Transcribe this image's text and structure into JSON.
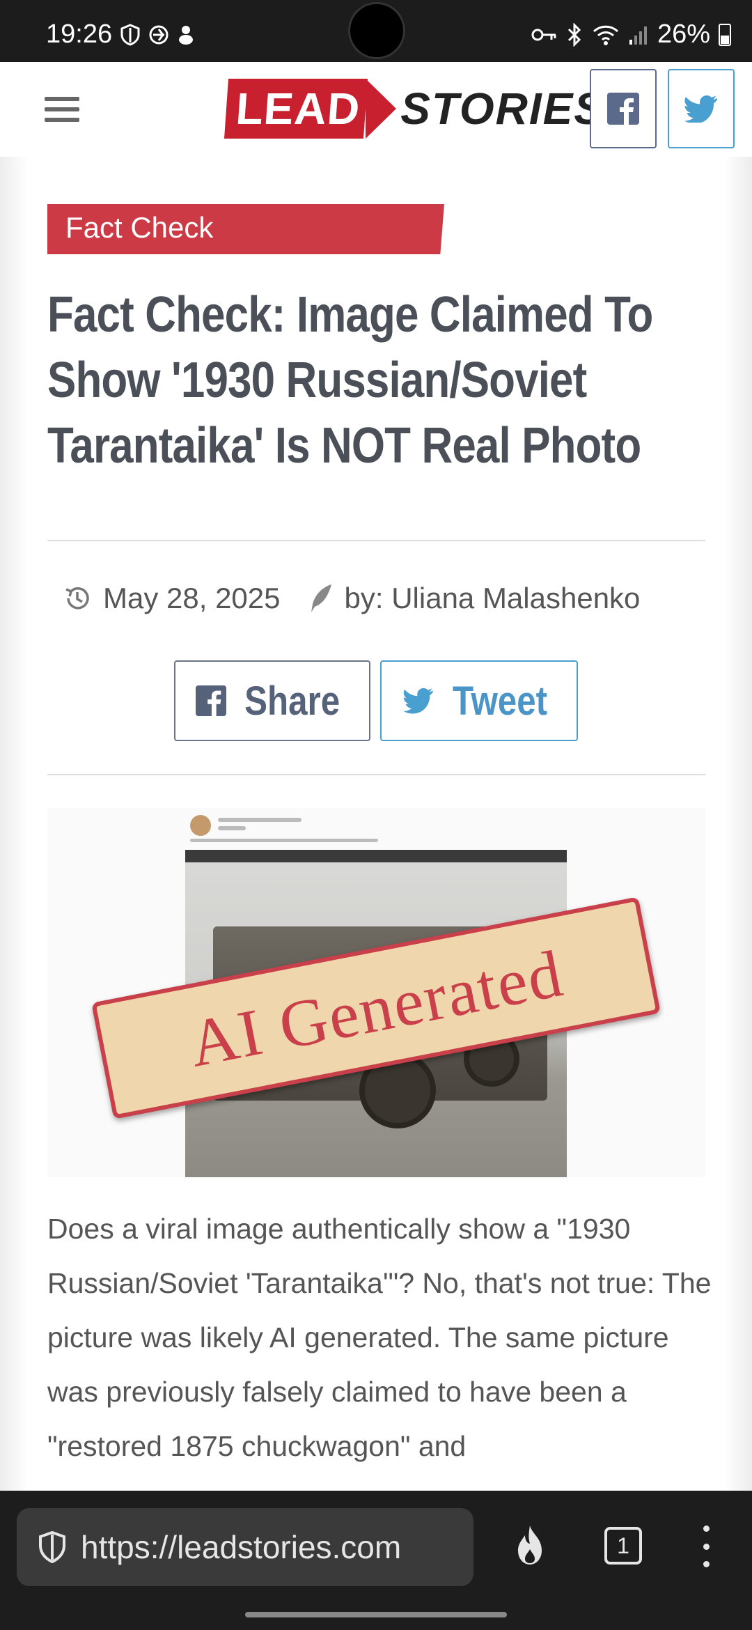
{
  "status_bar": {
    "time": "19:26",
    "battery": "26%",
    "icons": [
      "shield-icon",
      "vpn-icon",
      "notification-icon",
      "key-icon",
      "bluetooth-icon",
      "wifi-icon",
      "signal-icon",
      "battery-icon"
    ]
  },
  "header": {
    "logo_lead": "LEAD",
    "logo_stories": "STORIES",
    "icons": [
      "menu-icon",
      "facebook-icon",
      "twitter-icon"
    ]
  },
  "article": {
    "category": "Fact Check",
    "title": "Fact Check: Image Claimed To Show '1930 Russian/Soviet Tarantaika' Is NOT Real Photo",
    "date": "May 28, 2025",
    "author": "by: Uliana Malashenko",
    "share_label": "Share",
    "tweet_label": "Tweet",
    "image_stamp": "AI Generated",
    "body": "Does a viral image authentically show a \"1930 Russian/Soviet 'Tarantaika'\"? No, that's not true: The picture was likely AI generated. The same picture was previously falsely claimed to have been a \"restored 1875 chuckwagon\" and"
  },
  "browser": {
    "url": "https://leadstories.com",
    "tab_count": "1"
  },
  "colors": {
    "brand_red": "#cc3b45",
    "facebook": "#5b6a8a",
    "twitter": "#4a9fd1",
    "title_text": "#4a4f58"
  }
}
